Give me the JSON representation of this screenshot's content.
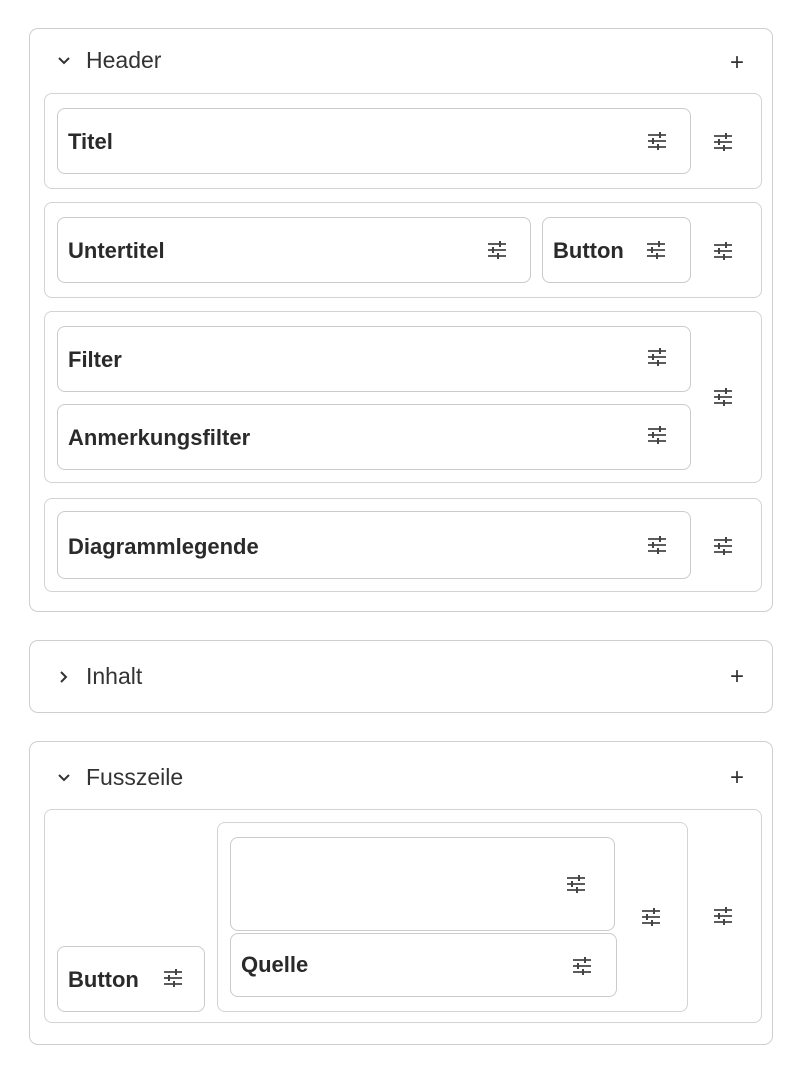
{
  "sections": {
    "header": {
      "title": "Header",
      "expanded": true,
      "add_label": "+"
    },
    "inhalt": {
      "title": "Inhalt",
      "expanded": false,
      "add_label": "+"
    },
    "fusszeile": {
      "title": "Fusszeile",
      "expanded": true,
      "add_label": "+"
    }
  },
  "header_fields": {
    "titel": "Titel",
    "untertitel": "Untertitel",
    "button": "Button",
    "filter": "Filter",
    "anmerkungsfilter": "Anmerkungsfilter",
    "diagrammlegende": "Diagrammlegende"
  },
  "footer_fields": {
    "button": "Button",
    "empty_field": "",
    "quelle": "Quelle"
  },
  "icons": {
    "settings": "sliders-settings-icon",
    "chevron_down": "chevron-down-icon",
    "chevron_right": "chevron-right-icon",
    "add": "plus-icon"
  }
}
